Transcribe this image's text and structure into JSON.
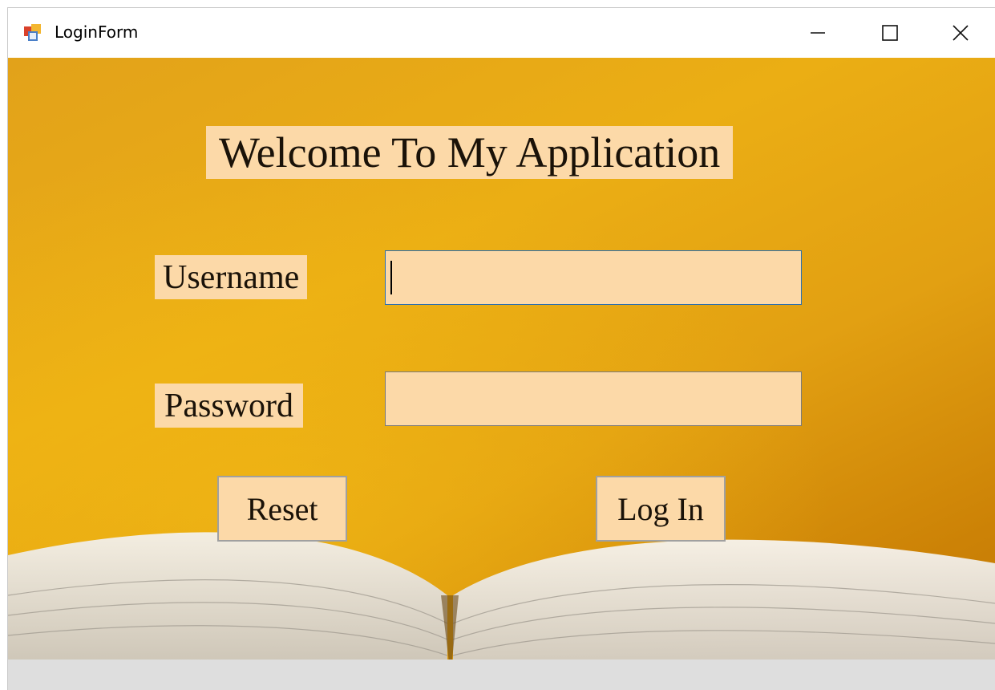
{
  "window": {
    "title": "LoginForm",
    "icon": "form-app-icon",
    "controls": [
      "minimize-icon",
      "maximize-icon",
      "close-icon"
    ]
  },
  "form": {
    "welcome": "Welcome To My Application",
    "username_label": "Username",
    "username_value": "",
    "password_label": "Password",
    "password_value": "",
    "reset_label": "Reset",
    "login_label": "Log In"
  },
  "colors": {
    "background_gold": "#e2a21a",
    "label_bg": "#fcd9a8",
    "focus_border": "#2a6fb0"
  }
}
